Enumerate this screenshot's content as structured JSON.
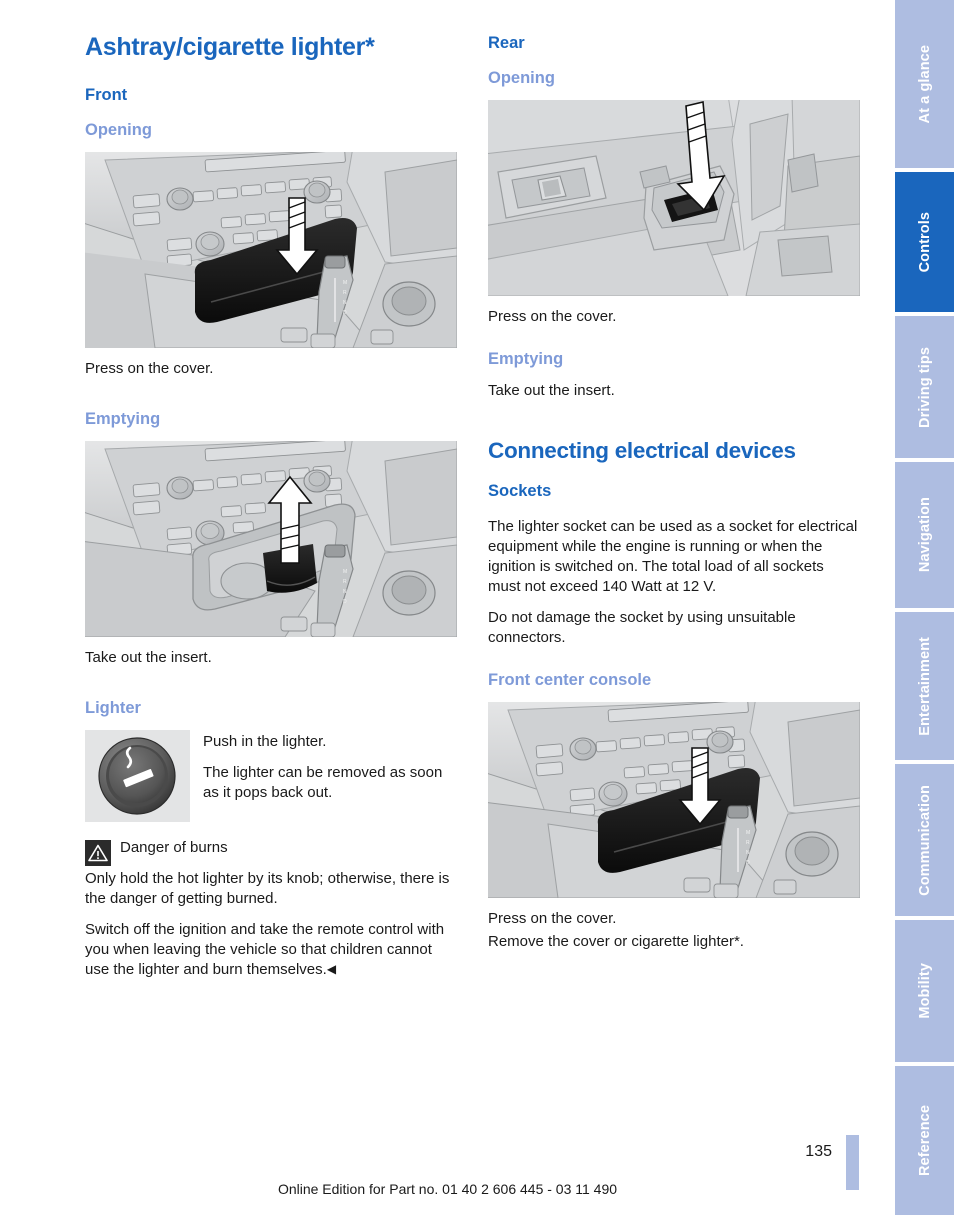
{
  "document": {
    "title": "Ashtray/cigarette lighter*",
    "page_number": "135",
    "edition_line": "Online Edition for Part no. 01 40 2 606 445 - 03 11 490"
  },
  "colors": {
    "heading_blue": "#1a66bd",
    "subheading_light_blue": "#7e9ad8",
    "tab_inactive": "#aebde1",
    "tab_active": "#1a66bd",
    "figure_background": "#d9dadb",
    "warning_icon_background": "#2b2b2b"
  },
  "left_column": {
    "section_title": "Ashtray/cigarette lighter*",
    "front_heading": "Front",
    "opening_heading": "Opening",
    "opening_figure_alt": "front-center-console-ashtray-press-cover-illustration",
    "opening_caption": "Press on the cover.",
    "emptying_heading": "Emptying",
    "emptying_figure_alt": "front-center-console-ashtray-insert-removal-illustration",
    "emptying_caption": "Take out the insert.",
    "lighter_heading": "Lighter",
    "lighter_icon_alt": "cigarette-lighter-knob-symbol",
    "lighter_text_1": "Push in the lighter.",
    "lighter_text_2": "The lighter can be removed as soon as it pops back out.",
    "warning": {
      "icon_alt": "warning-triangle-icon",
      "title": "Danger of burns",
      "text": "Only hold the hot lighter by its knob; otherwise, there is the danger of getting burned.",
      "followup": "Switch off the ignition and take the remote control with you when leaving the vehicle so that children cannot use the lighter and burn themselves.",
      "end_marker": "◀"
    }
  },
  "right_column": {
    "rear_heading": "Rear",
    "opening_heading": "Opening",
    "rear_figure_alt": "rear-door-panel-ashtray-press-cover-illustration",
    "opening_caption": "Press on the cover.",
    "emptying_heading": "Emptying",
    "emptying_caption": "Take out the insert.",
    "devices_title": "Connecting electrical devices",
    "sockets_heading": "Sockets",
    "sockets_paragraph_1": "The lighter socket can be used as a socket for electrical equipment while the engine is running or when the ignition is switched on. The total load of all sockets must not exceed 140 Watt at 12 V.",
    "sockets_paragraph_2": "Do not damage the socket by using unsuitable connectors.",
    "console_heading": "Front center console",
    "console_figure_alt": "front-center-console-socket-cover-illustration",
    "console_caption_1": "Press on the cover.",
    "console_caption_2": "Remove the cover or cigarette lighter*."
  },
  "tabs": [
    {
      "label": "At a glance",
      "active": false
    },
    {
      "label": "Controls",
      "active": true
    },
    {
      "label": "Driving tips",
      "active": false
    },
    {
      "label": "Navigation",
      "active": false
    },
    {
      "label": "Entertainment",
      "active": false
    },
    {
      "label": "Communication",
      "active": false
    },
    {
      "label": "Mobility",
      "active": false
    },
    {
      "label": "Reference",
      "active": false
    }
  ]
}
